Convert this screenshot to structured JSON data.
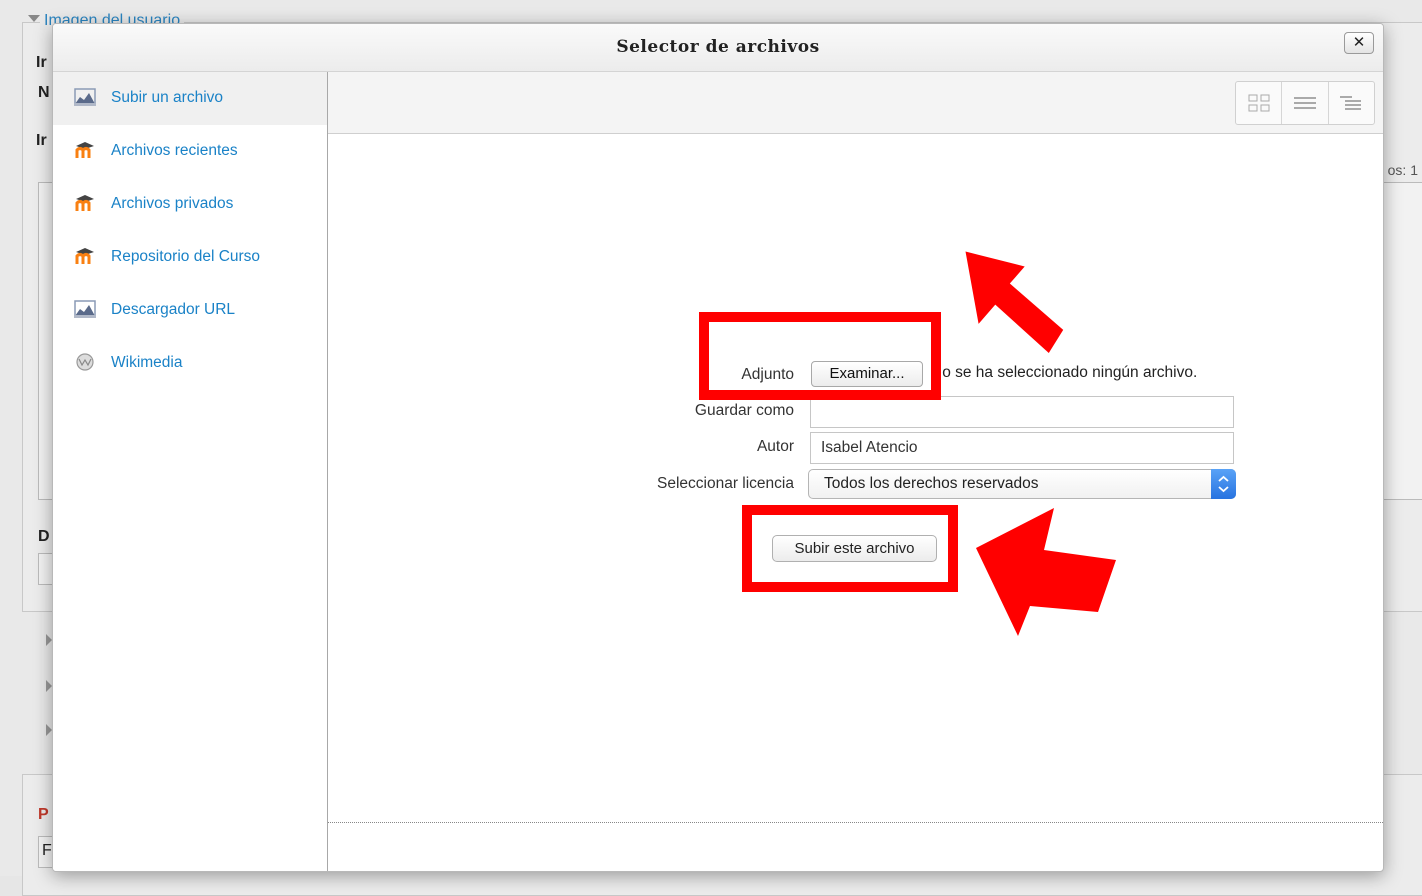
{
  "background": {
    "legend": "Imagen del usuario",
    "row_labels": [
      "Ir",
      "N",
      "Ir",
      "D",
      "P",
      "F"
    ],
    "side_text": "os: 1"
  },
  "dialog": {
    "title": "Selector de archivos",
    "close_label": "✕"
  },
  "sidebar": {
    "items": [
      {
        "label": "Subir un archivo",
        "icon": "upload-icon",
        "active": true
      },
      {
        "label": "Archivos recientes",
        "icon": "moodle-icon",
        "active": false
      },
      {
        "label": "Archivos privados",
        "icon": "moodle-icon",
        "active": false
      },
      {
        "label": "Repositorio del Curso",
        "icon": "moodle-icon",
        "active": false
      },
      {
        "label": "Descargador URL",
        "icon": "upload-icon",
        "active": false
      },
      {
        "label": "Wikimedia",
        "icon": "wikimedia-icon",
        "active": false
      }
    ]
  },
  "toolbar": {
    "views": [
      "icon-view-icon",
      "list-view-icon",
      "tree-view-icon"
    ]
  },
  "form": {
    "attachment_label": "Adjunto",
    "browse_button": "Examinar...",
    "no_file_text": "No se ha seleccionado ningún archivo.",
    "save_as_label": "Guardar como",
    "save_as_value": "",
    "author_label": "Autor",
    "author_value": "Isabel Atencio",
    "license_label": "Seleccionar licencia",
    "license_value": "Todos los derechos reservados",
    "upload_button": "Subir este archivo"
  },
  "colors": {
    "link": "#1a82c7",
    "annotation": "#ff0000",
    "moodle_orange": "#f98012"
  }
}
